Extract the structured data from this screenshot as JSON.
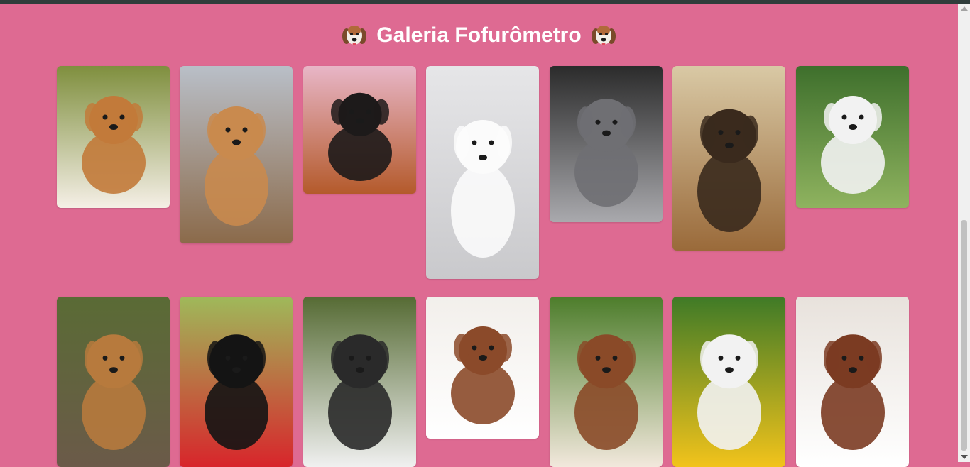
{
  "page": {
    "title": "Galeria Fofurômetro",
    "icon_left": "dog-face-icon",
    "icon_right": "dog-face-icon",
    "background_color": "#de6a92",
    "title_color": "#ffffff"
  },
  "gallery": {
    "photos": [
      {
        "name": "corgi-standing-photo",
        "palette": [
          "#7f8f3e",
          "#c27a3a",
          "#f5efe6"
        ]
      },
      {
        "name": "dogue-de-bordeaux-puppy-photo",
        "palette": [
          "#b9bfc8",
          "#c98a4e",
          "#8b6a4a"
        ]
      },
      {
        "name": "dachshund-puppy-photo",
        "palette": [
          "#e8b6c7",
          "#1d1a1a",
          "#b45a2b"
        ]
      },
      {
        "name": "white-puppy-photo",
        "palette": [
          "#e6e6e8",
          "#fbfbfb",
          "#c9c9cc"
        ]
      },
      {
        "name": "weimaraner-puppy-photo",
        "palette": [
          "#2b2b2b",
          "#6f6f73",
          "#a9a9ad"
        ]
      },
      {
        "name": "tibetan-mastiff-puppy-photo",
        "palette": [
          "#d9c9a5",
          "#3a2a1d",
          "#9a6a3a"
        ]
      },
      {
        "name": "samoyed-running-photo",
        "palette": [
          "#3e6f2c",
          "#f2f2f2",
          "#8fb35f"
        ]
      },
      {
        "name": "yorkshire-terrier-photo",
        "palette": [
          "#5a6b35",
          "#b77a3d",
          "#6b5a49"
        ]
      },
      {
        "name": "cocker-spaniel-bucket-photo",
        "palette": [
          "#9fb95a",
          "#141414",
          "#d8252b"
        ]
      },
      {
        "name": "husky-photo",
        "palette": [
          "#566b34",
          "#2a2a2a",
          "#f0f0f0"
        ]
      },
      {
        "name": "sleeping-puppy-photo",
        "palette": [
          "#f2efeb",
          "#8b4a2a",
          "#ffffff"
        ]
      },
      {
        "name": "australian-shepherd-photo",
        "palette": [
          "#4d7d2b",
          "#8a4a28",
          "#f2e8dc"
        ]
      },
      {
        "name": "bulldog-ball-photo",
        "palette": [
          "#3f7a27",
          "#f2f2f2",
          "#f2c31b"
        ]
      },
      {
        "name": "cavalier-spaniel-photo",
        "palette": [
          "#e8e2dc",
          "#7b3b22",
          "#ffffff"
        ]
      }
    ]
  }
}
